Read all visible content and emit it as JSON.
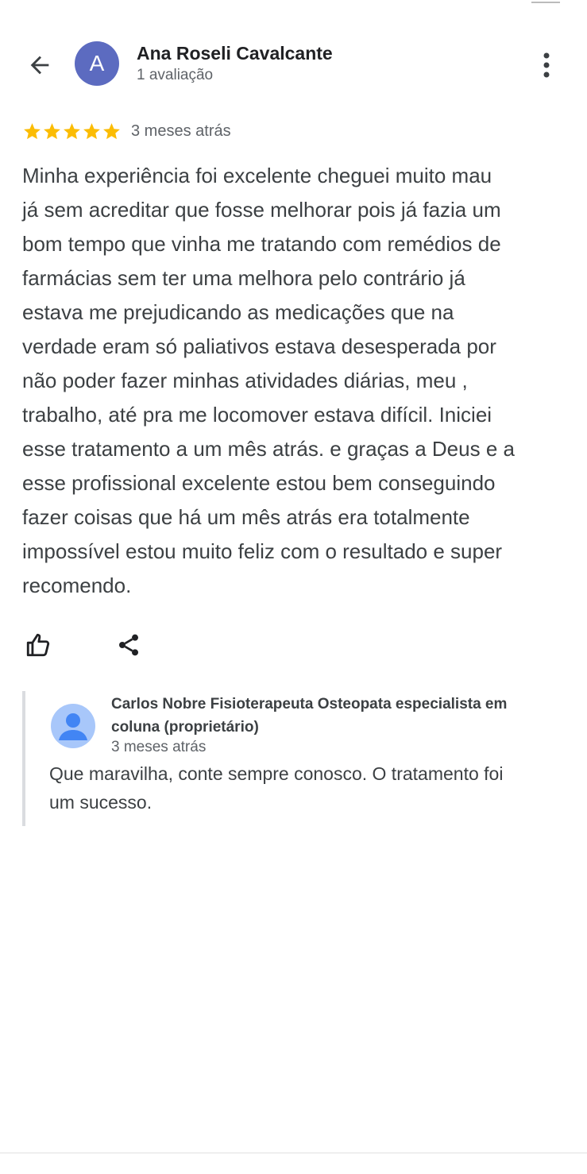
{
  "reviewer": {
    "initial": "A",
    "name": "Ana Roseli Cavalcante",
    "review_count": "1 avaliação",
    "avatar_color": "#5c6bc0"
  },
  "review": {
    "rating": 5,
    "max_rating": 5,
    "date": "3 meses atrás",
    "text_lines": [
      "Minha experiência foi excelente cheguei muito mau",
      "já sem acreditar que fosse melhorar pois já fazia um",
      "bom tempo que vinha me tratando com remédios de",
      "farmácias sem ter uma melhora pelo contrário já",
      "estava me prejudicando as medicações que na",
      "verdade eram só paliativos estava desesperada por",
      "não poder fazer minhas atividades diárias, meu ,",
      "trabalho, até pra me locomover estava difícil. Iniciei",
      "esse tratamento a um mês atrás. e graças a Deus e a",
      "esse profissional excelente estou bem conseguindo",
      "fazer coisas que há um mês atrás era totalmente",
      "impossível estou muito feliz com o resultado e super",
      "recomendo."
    ]
  },
  "actions": {
    "like_icon": "thumbs-up-icon",
    "share_icon": "share-icon"
  },
  "owner_reply": {
    "name_line1": "Carlos Nobre Fisioterapeuta Osteopata especialista em",
    "name_line2": "coluna (proprietário)",
    "date": "3 meses atrás",
    "text_line1": "Que maravilha, conte sempre conosco. O tratamento foi",
    "text_line2": "um sucesso."
  },
  "colors": {
    "star": "#fbbc04",
    "accent_avatar": "#5c6bc0",
    "owner_avatar_bg": "#a8c7fa",
    "owner_avatar_fg": "#4285f4"
  }
}
